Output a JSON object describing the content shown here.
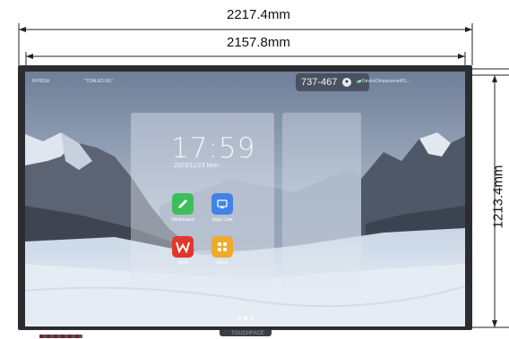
{
  "dimensions": {
    "total_width": "2217.4mm",
    "screen_width": "2157.8mm",
    "height": "1213.4mm"
  },
  "status_bar": {
    "model": "IFP653d",
    "wifi": "\"TOALED-5G\"",
    "meeting_code": "737-467",
    "device_name": "DeviceDimpleserie451..."
  },
  "clock": {
    "time": "17:59",
    "date": "2023/11/23 Mon"
  },
  "apps": [
    {
      "label": "Whiteboard",
      "icon": "pencil-icon",
      "color": "#3cbf5a"
    },
    {
      "label": "Airgo Cast",
      "icon": "cast-icon",
      "color": "#3f84e6"
    },
    {
      "label": "WPS",
      "icon": "wps-icon",
      "color": "#e2372d"
    },
    {
      "label": "More",
      "icon": "grid-icon",
      "color": "#f0a92b"
    }
  ],
  "brand": "TOUCHFACE"
}
